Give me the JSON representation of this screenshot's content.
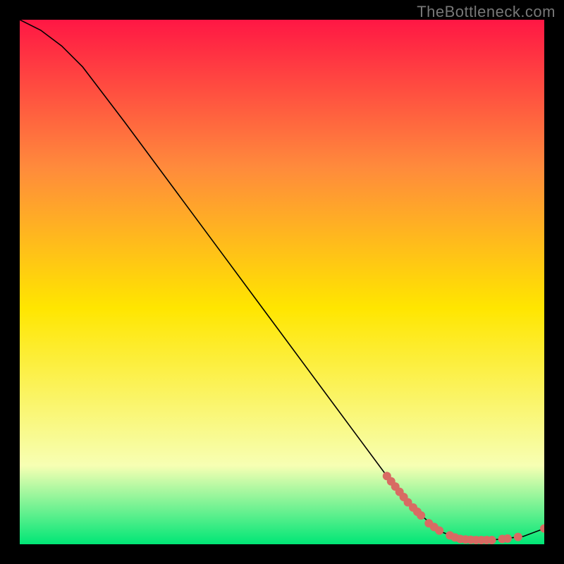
{
  "watermark": "TheBottleneck.com",
  "chart_data": {
    "type": "line",
    "title": "",
    "xlabel": "",
    "ylabel": "",
    "xlim": [
      0,
      100
    ],
    "ylim": [
      0,
      100
    ],
    "grid": false,
    "legend": false,
    "background_gradient": {
      "top_color": "#ff1744",
      "upper_mid_color": "#ff8a3c",
      "mid_color": "#ffe600",
      "lower_color": "#f7ffb3",
      "bottom_color": "#00e676"
    },
    "curve": [
      {
        "x": 0,
        "y": 100
      },
      {
        "x": 4,
        "y": 98
      },
      {
        "x": 8,
        "y": 95
      },
      {
        "x": 12,
        "y": 91
      },
      {
        "x": 20,
        "y": 80.5
      },
      {
        "x": 30,
        "y": 67
      },
      {
        "x": 40,
        "y": 53.5
      },
      {
        "x": 50,
        "y": 40
      },
      {
        "x": 60,
        "y": 26.5
      },
      {
        "x": 70,
        "y": 13
      },
      {
        "x": 76,
        "y": 6
      },
      {
        "x": 80,
        "y": 2.5
      },
      {
        "x": 84,
        "y": 1
      },
      {
        "x": 90,
        "y": 0.8
      },
      {
        "x": 96,
        "y": 1.5
      },
      {
        "x": 100,
        "y": 3
      }
    ],
    "scatter_points": [
      {
        "x": 70.0,
        "y": 13.0
      },
      {
        "x": 70.8,
        "y": 12.0
      },
      {
        "x": 71.6,
        "y": 11.0
      },
      {
        "x": 72.4,
        "y": 10.0
      },
      {
        "x": 73.2,
        "y": 9.0
      },
      {
        "x": 74.0,
        "y": 8.0
      },
      {
        "x": 75.0,
        "y": 7.0
      },
      {
        "x": 75.8,
        "y": 6.2
      },
      {
        "x": 76.5,
        "y": 5.5
      },
      {
        "x": 78.0,
        "y": 4.0
      },
      {
        "x": 79.0,
        "y": 3.3
      },
      {
        "x": 80.0,
        "y": 2.6
      },
      {
        "x": 82.0,
        "y": 1.7
      },
      {
        "x": 83.0,
        "y": 1.3
      },
      {
        "x": 84.0,
        "y": 1.0
      },
      {
        "x": 85.0,
        "y": 0.9
      },
      {
        "x": 86.0,
        "y": 0.85
      },
      {
        "x": 87.0,
        "y": 0.8
      },
      {
        "x": 88.0,
        "y": 0.8
      },
      {
        "x": 89.0,
        "y": 0.8
      },
      {
        "x": 90.0,
        "y": 0.8
      },
      {
        "x": 92.0,
        "y": 1.0
      },
      {
        "x": 93.0,
        "y": 1.1
      },
      {
        "x": 95.0,
        "y": 1.4
      },
      {
        "x": 100.0,
        "y": 3.0
      }
    ],
    "scatter_color": "#d86b63",
    "line_color": "#000000"
  }
}
